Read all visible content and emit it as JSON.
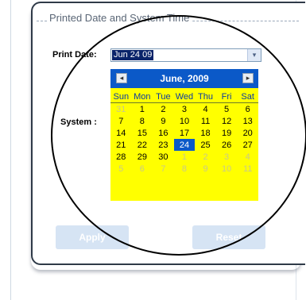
{
  "section": {
    "legend": "Printed Date and System Time"
  },
  "print_date": {
    "label": "Print Date:",
    "value": "Jun 24 09",
    "dropdown_glyph": "▾"
  },
  "system": {
    "label": "System :"
  },
  "calendar": {
    "title": "June, 2009",
    "prev_glyph": "◂",
    "next_glyph": "▸",
    "weekdays": [
      "Sun",
      "Mon",
      "Tue",
      "Wed",
      "Thu",
      "Fri",
      "Sat"
    ],
    "weeks": [
      [
        "31",
        "1",
        "2",
        "3",
        "4",
        "5",
        "6"
      ],
      [
        "7",
        "8",
        "9",
        "10",
        "11",
        "12",
        "13"
      ],
      [
        "14",
        "15",
        "16",
        "17",
        "18",
        "19",
        "20"
      ],
      [
        "21",
        "22",
        "23",
        "24",
        "25",
        "26",
        "27"
      ],
      [
        "28",
        "29",
        "30",
        "1",
        "2",
        "3",
        "4"
      ],
      [
        "5",
        "6",
        "7",
        "8",
        "9",
        "10",
        "11"
      ]
    ],
    "selected_day": "24",
    "colors": {
      "background": "#ffff00",
      "header": "#0b59c8",
      "selected": "#0b59c8"
    }
  },
  "buttons": {
    "apply": "Apply",
    "reset": "Reset"
  }
}
